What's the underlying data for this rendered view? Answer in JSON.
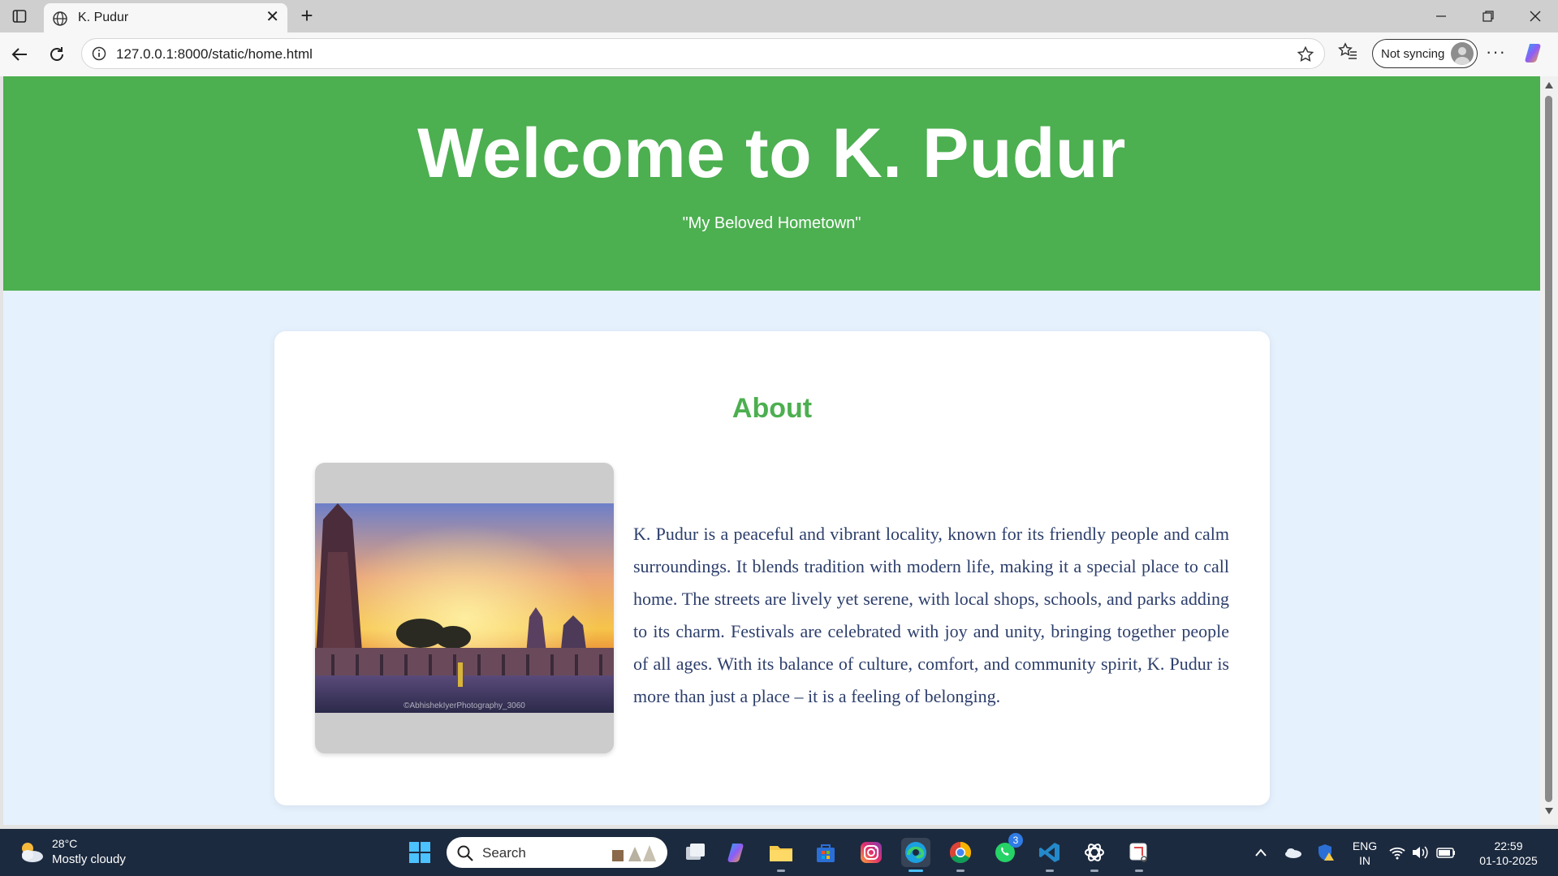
{
  "browser": {
    "tab_title": "K. Pudur",
    "url": "127.0.0.1:8000/static/home.html",
    "sync_label": "Not syncing"
  },
  "page": {
    "hero_title": "Welcome to K. Pudur",
    "hero_tagline": "\"My Beloved Hometown\"",
    "section_title": "About",
    "photo_watermark": "©AbhishekIyerPhotography_3060",
    "about_text": "K. Pudur is a peaceful and vibrant locality, known for its friendly people and calm surroundings. It blends tradition with modern life, making it a special place to call home. The streets are lively yet serene, with local shops, schools, and parks adding to its charm. Festivals are celebrated with joy and unity, bringing together people of all ages. With its balance of culture, comfort, and community spirit, K. Pudur is more than just a place – it is a feeling of belonging.",
    "colors": {
      "hero_bg": "#4caf50",
      "page_bg": "#e6f1fe",
      "text": "#2c3e6b"
    }
  },
  "taskbar": {
    "weather_temp": "28°C",
    "weather_desc": "Mostly cloudy",
    "search_placeholder": "Search",
    "whatsapp_badge": "3",
    "lang_top": "ENG",
    "lang_bottom": "IN",
    "time": "22:59",
    "date": "01-10-2025"
  }
}
